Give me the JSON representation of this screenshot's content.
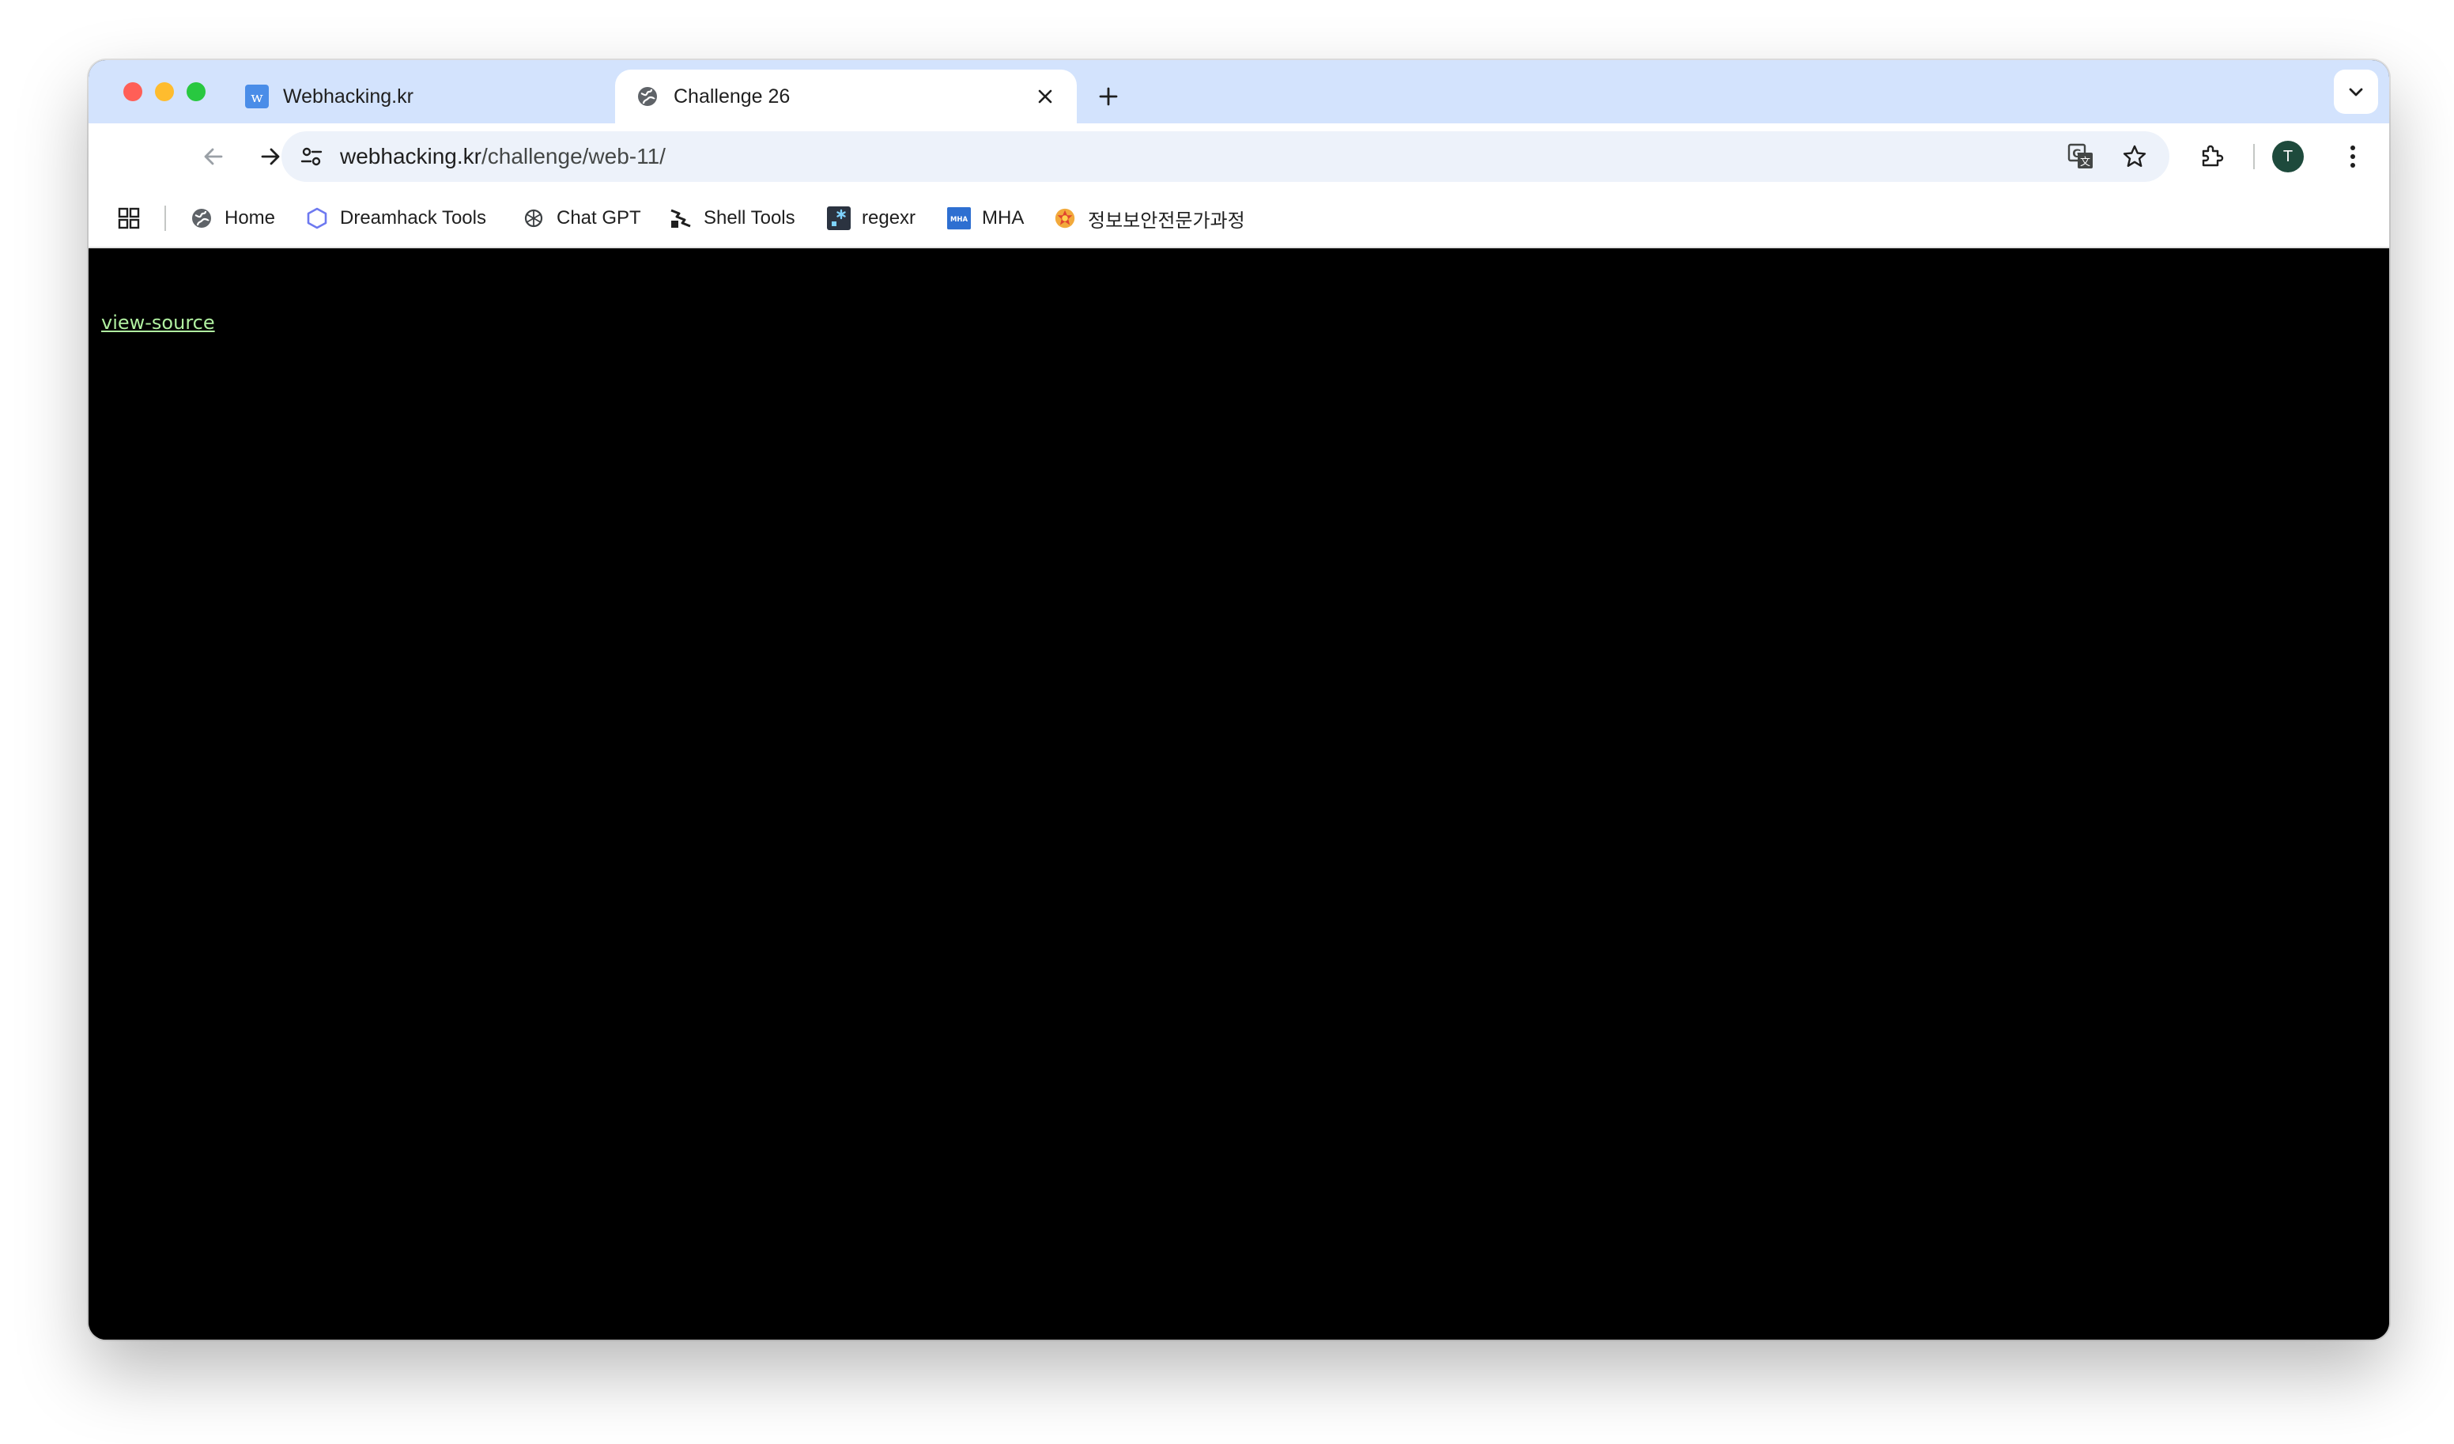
{
  "tabs": [
    {
      "title": "Webhacking.kr",
      "favicon": "w-logo-icon"
    },
    {
      "title": "Challenge 26",
      "favicon": "globe-icon",
      "active": true
    }
  ],
  "address_bar": {
    "host": "webhacking.kr",
    "path": "/challenge/web-11/"
  },
  "profile": {
    "initial": "T"
  },
  "bookmarks": [
    {
      "label": "Home",
      "icon": "globe-icon"
    },
    {
      "label": "Dreamhack Tools",
      "icon": "hexagon-icon"
    },
    {
      "label": "Chat GPT",
      "icon": "openai-icon"
    },
    {
      "label": "Shell Tools",
      "icon": "shell-icon"
    },
    {
      "label": "regexr",
      "icon": "regexr-icon"
    },
    {
      "label": "MHA",
      "icon": "mha-icon"
    },
    {
      "label": "정보보안전문가과정",
      "icon": "emblem-icon"
    }
  ],
  "page": {
    "link_text": "view-source",
    "link_color": "#b0f0a0",
    "background": "#000000"
  },
  "colors": {
    "tabstrip": "#d3e3fd",
    "omnibox": "#edf2fa",
    "avatar": "#1e4a3c"
  }
}
